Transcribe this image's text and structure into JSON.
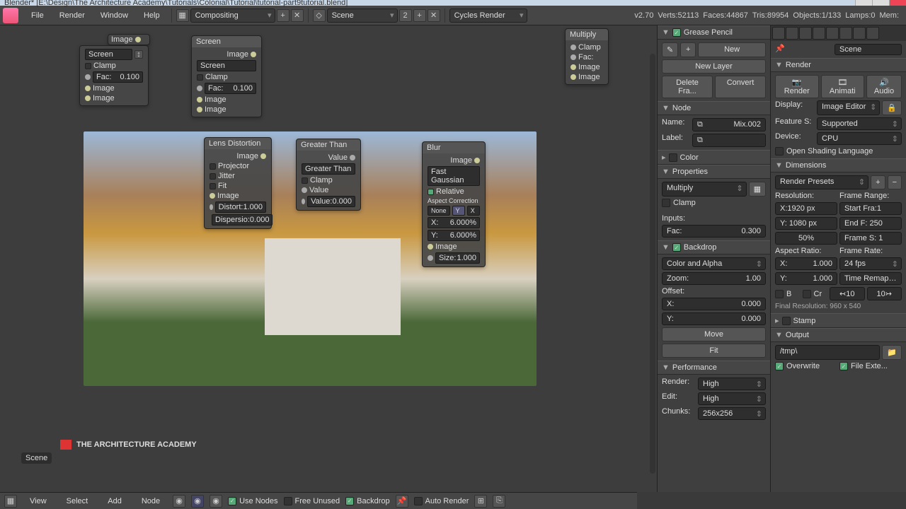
{
  "title": "Blender* [E:\\Design\\The Architecture Academy\\Tutorials\\Colonial\\Tutorial\\tutorial-part9tutorial.blend]",
  "menu": {
    "file": "File",
    "render": "Render",
    "window": "Window",
    "help": "Help"
  },
  "editors": {
    "compositing": "Compositing",
    "scene": "Scene",
    "scene_num": "2",
    "engine": "Cycles Render"
  },
  "stats": {
    "version": "v2.70",
    "verts": "Verts:52113",
    "faces": "Faces:44867",
    "tris": "Tris:89954",
    "objects": "Objects:1/133",
    "lamps": "Lamps:0",
    "mem": "Mem:"
  },
  "nodes": {
    "image": {
      "title": "Image",
      "out": "Image"
    },
    "mix1": {
      "sel": "Screen",
      "clamp": "Clamp",
      "fac": "Fac:",
      "fac_val": "0.100",
      "img": "Image"
    },
    "mix2": {
      "sel": "Screen",
      "clamp": "Clamp",
      "fac": "Fac:",
      "fac_val": "0.100",
      "img": "Image"
    },
    "mix3": {
      "sel": "Multiply",
      "clamp": "Clamp",
      "fac": "Fac:",
      "img": "Image"
    },
    "lens": {
      "title": "Lens Distortion",
      "out": "Image",
      "projector": "Projector",
      "jitter": "Jitter",
      "fit": "Fit",
      "inimg": "Image",
      "distort": "Distort:",
      "distort_v": "1.000",
      "dispersio": "Dispersio:",
      "dispersio_v": "0.000"
    },
    "gt": {
      "title": "Greater Than",
      "out": "Value",
      "sel": "Greater Than",
      "clamp": "Clamp",
      "value": "Value",
      "val_l": "Value:",
      "val_v": "0.000"
    },
    "blur": {
      "title": "Blur",
      "out": "Image",
      "type": "Fast Gaussian",
      "rel": "Relative",
      "aspect": "Aspect Correction",
      "none": "None",
      "y": "Y",
      "x": "X",
      "xl": "X:",
      "xv": "6.000%",
      "yl": "Y:",
      "yv": "6.000%",
      "inimg": "Image",
      "size": "Size:",
      "size_v": "1.000"
    }
  },
  "panelR": {
    "gp": "Grease Pencil",
    "new": "New",
    "newlayer": "New Layer",
    "del": "Delete Fra...",
    "conv": "Convert",
    "node": "Node",
    "name": "Name:",
    "name_v": "Mix.002",
    "label": "Label:",
    "color": "Color",
    "properties": "Properties",
    "prop_sel": "Multiply",
    "prop_clamp": "Clamp",
    "inputs": "Inputs:",
    "fac": "Fac:",
    "fac_v": "0.300",
    "backdrop": "Backdrop",
    "bdmode": "Color and Alpha",
    "zoom": "Zoom:",
    "zoom_v": "1.00",
    "offset": "Offset:",
    "ox": "X:",
    "ox_v": "0.000",
    "oy": "Y:",
    "oy_v": "0.000",
    "move": "Move",
    "fit": "Fit",
    "perf": "Performance",
    "rend": "Render:",
    "rend_v": "High",
    "edit": "Edit:",
    "edit_v": "High",
    "chunks": "Chunks:",
    "chunks_v": "256x256"
  },
  "panelR2": {
    "scene": "Scene",
    "render": "Render",
    "rbtn": "Render",
    "abtn": "Animati",
    "audbtn": "Audio",
    "display": "Display:",
    "display_v": "Image Editor",
    "feature": "Feature S:",
    "feature_v": "Supported",
    "device": "Device:",
    "device_v": "CPU",
    "osl": "Open Shading Language",
    "dimensions": "Dimensions",
    "presets": "Render Presets",
    "resolution": "Resolution:",
    "rx_l": "X:1920 px",
    "ry_l": "Y: 1080 px",
    "rpct": "50%",
    "framerange": "Frame Range:",
    "sf": "Start Fra:1",
    "ef": "End F: 250",
    "fs": "Frame S: 1",
    "aspect": "Aspect Ratio:",
    "ax": "X:",
    "ax_v": "1.000",
    "ay": "Y:",
    "ay_v": "1.000",
    "framerate": "Frame Rate:",
    "fps": "24 fps",
    "timeremap": "Time Remap…",
    "b": "B",
    "cr": "Cr",
    "tr1l": "↢10",
    "tr2l": "10↣",
    "finalres": "Final Resolution: 960 x 540",
    "stamp": "Stamp",
    "output": "Output",
    "outpath": "/tmp\\",
    "overwrite": "Overwrite",
    "fileext": "File Exte..."
  },
  "bot": {
    "view": "View",
    "select": "Select",
    "add": "Add",
    "node": "Node",
    "usenodes": "Use Nodes",
    "freeunused": "Free Unused",
    "backdrop": "Backdrop",
    "autorender": "Auto Render"
  },
  "scene_label": "Scene",
  "badge": "THE ARCHITECTURE\nACADEMY"
}
